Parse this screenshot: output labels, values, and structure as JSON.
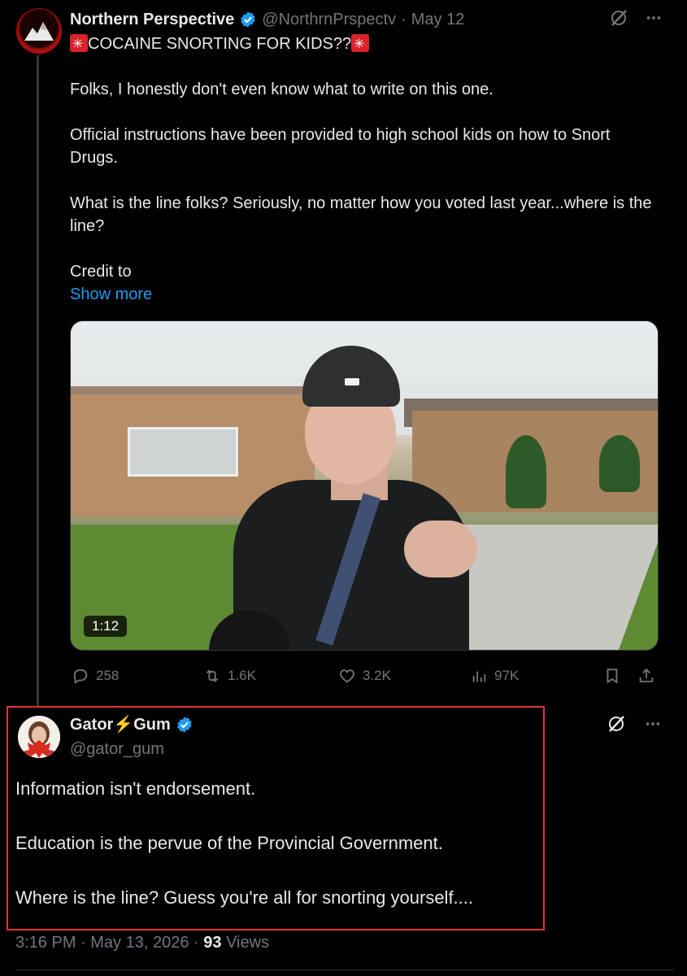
{
  "tweet": {
    "author_name": "Northern Perspective",
    "author_handle": "@NorthrnPrspectv",
    "separator": "·",
    "date": "May 12",
    "title_line": "COCAINE SNORTING FOR KIDS??",
    "paragraphs": [
      "Folks, I honestly don't even know what to write on this one.",
      "Official instructions have been provided to high school kids on how to Snort Drugs.",
      "What is the line folks? Seriously, no matter how you voted last year...where is the line?",
      "Credit to"
    ],
    "show_more": "Show more",
    "video_duration": "1:12",
    "stats": {
      "replies": "258",
      "reposts": "1.6K",
      "likes": "3.2K",
      "views": "97K"
    }
  },
  "reply": {
    "author_name_part1": "Gator",
    "author_name_part2": "Gum",
    "author_handle": "@gator_gum",
    "paragraphs": [
      "Information isn't endorsement.",
      "Education is the pervue of the Provincial Government.",
      "Where is the line? Guess you're all for snorting yourself...."
    ],
    "time": "3:16 PM",
    "date": "May 13, 2026",
    "views_count": "93",
    "views_label": "Views"
  },
  "icons": {
    "verified": "verified-badge-icon",
    "grok": "grok-icon",
    "more": "more-icon",
    "reply": "reply-icon",
    "repost": "repost-icon",
    "like": "like-icon",
    "views": "views-icon",
    "bookmark": "bookmark-icon",
    "share": "share-icon"
  },
  "colors": {
    "background": "#000000",
    "text": "#e7e9ea",
    "muted": "#71767b",
    "link": "#1d9bf0",
    "verified": "#1d9bf0",
    "highlight_border": "#e0343a"
  }
}
